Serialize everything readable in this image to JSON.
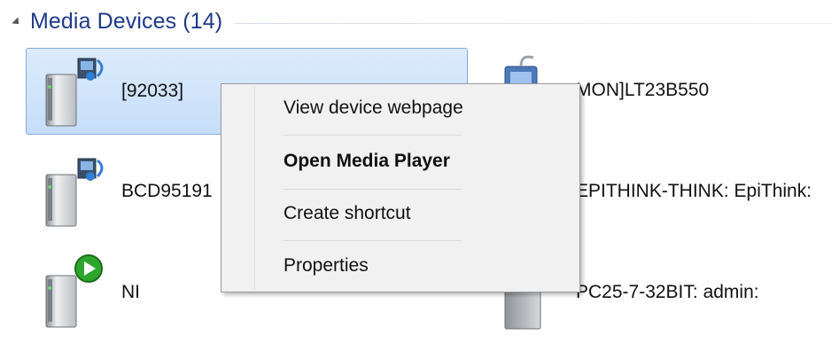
{
  "group": {
    "title": "Media Devices (14)"
  },
  "devices": [
    {
      "label": "[92033]",
      "type": "media-device",
      "selected": true
    },
    {
      "label": "BCD95191",
      "type": "media-device",
      "selected": false
    },
    {
      "label": "NI",
      "type": "media-player-device",
      "selected": false
    },
    {
      "label": "MON]LT23B550",
      "type": "network-device",
      "selected": false
    },
    {
      "label": "EPITHINK-THINK: EpiThink:",
      "type": "computer",
      "selected": false
    },
    {
      "label": "PC25-7-32BIT: admin:",
      "type": "computer",
      "selected": false
    }
  ],
  "context_menu": {
    "items": [
      {
        "label": "View device webpage",
        "bold": false
      },
      {
        "label": "Open Media Player",
        "bold": true
      },
      {
        "label": "Create shortcut",
        "bold": false
      },
      {
        "label": "Properties",
        "bold": false
      }
    ]
  },
  "colors": {
    "group_title": "#1e3a8a",
    "selection_fill": "#c6defa",
    "selection_border": "#84acdd",
    "menu_background": "#f1f1f1"
  }
}
